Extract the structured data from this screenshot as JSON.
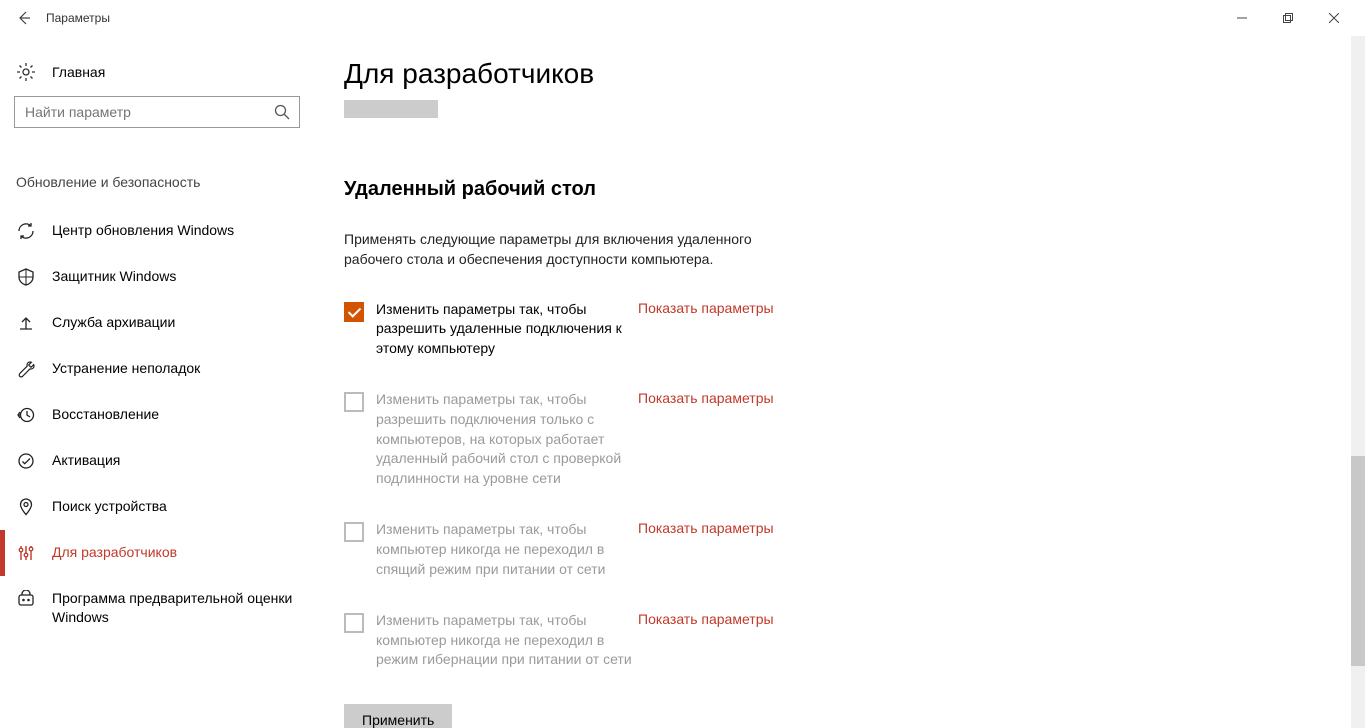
{
  "titlebar": {
    "title": "Параметры"
  },
  "sidebar": {
    "home_label": "Главная",
    "search_placeholder": "Найти параметр",
    "section_header": "Обновление и безопасность",
    "items": [
      {
        "label": "Центр обновления Windows"
      },
      {
        "label": "Защитник Windows"
      },
      {
        "label": "Служба архивации"
      },
      {
        "label": "Устранение неполадок"
      },
      {
        "label": "Восстановление"
      },
      {
        "label": "Активация"
      },
      {
        "label": "Поиск устройства"
      },
      {
        "label": "Для разработчиков"
      },
      {
        "label": "Программа предварительной оценки Windows"
      }
    ]
  },
  "content": {
    "page_title": "Для разработчиков",
    "sub_heading": "Удаленный рабочий стол",
    "desc": "Применять следующие параметры для включения удаленного рабочего стола и обеспечения доступности компьютера.",
    "show_settings": "Показать параметры",
    "options": [
      {
        "label": "Изменить параметры так, чтобы разрешить удаленные подключения к этому компьютеру",
        "checked": true,
        "disabled": false
      },
      {
        "label": "Изменить параметры так, чтобы разрешить подключения только с компьютеров, на которых работает удаленный рабочий стол с проверкой подлинности на уровне сети",
        "checked": false,
        "disabled": true
      },
      {
        "label": "Изменить параметры так, чтобы компьютер никогда не переходил в спящий режим при питании от сети",
        "checked": false,
        "disabled": true
      },
      {
        "label": "Изменить параметры так, чтобы компьютер никогда не переходил в режим гибернации при питании от сети",
        "checked": false,
        "disabled": true
      }
    ],
    "apply_label": "Применить"
  }
}
